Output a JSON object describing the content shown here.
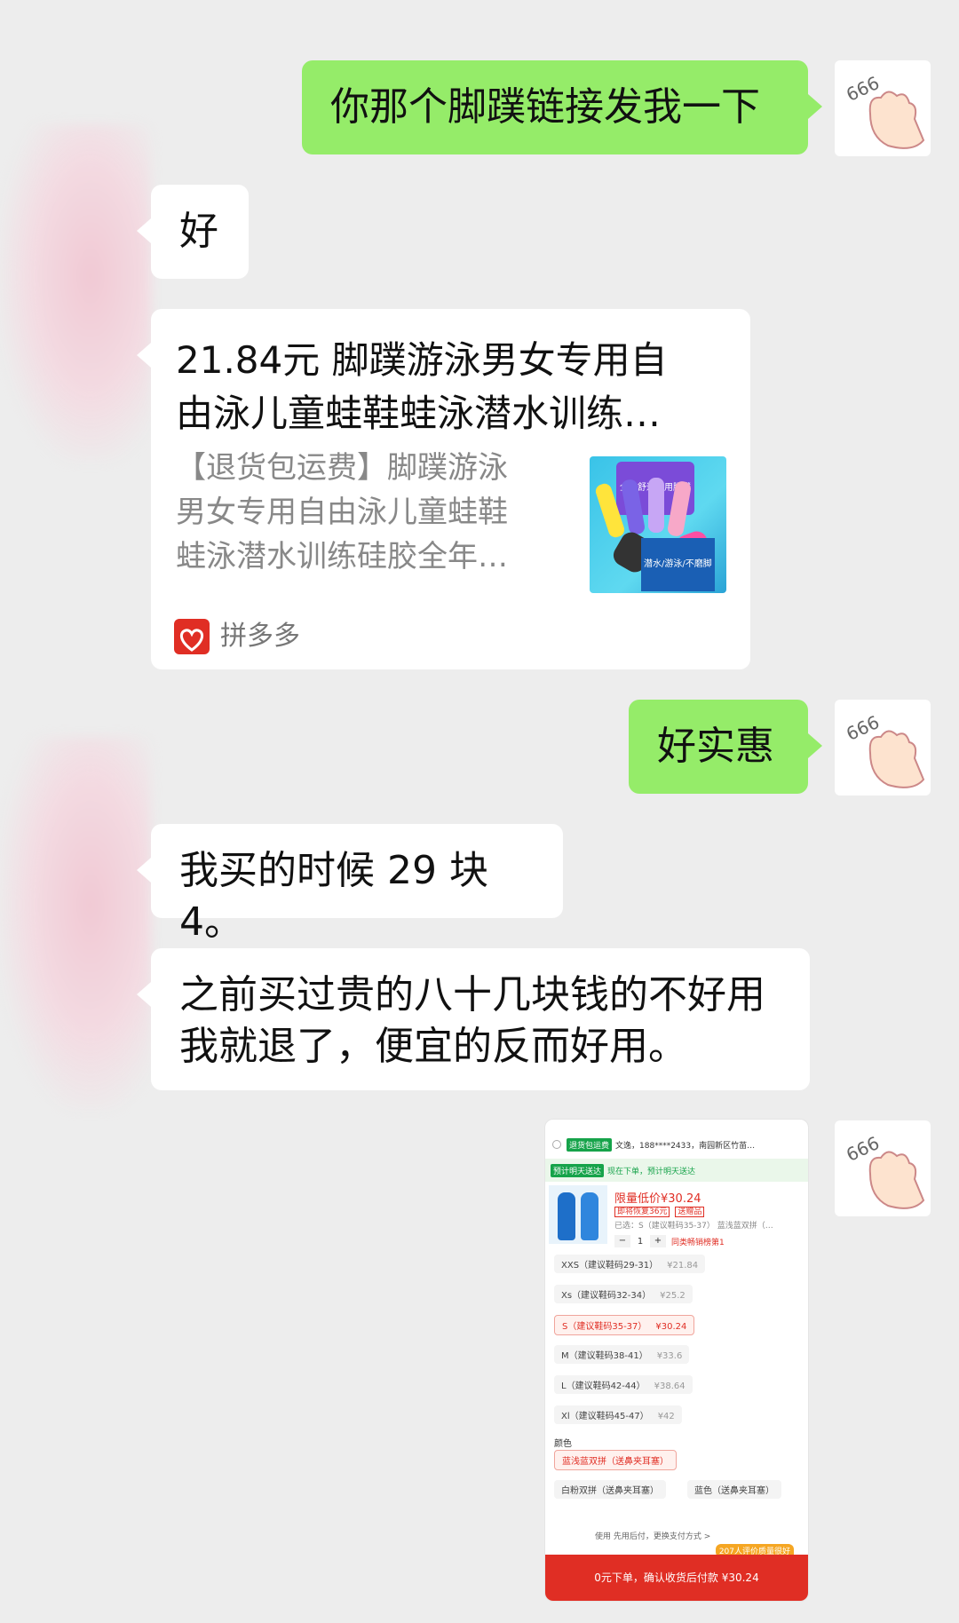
{
  "messages": [
    {
      "side": "right",
      "type": "text",
      "text": "你那个脚蹼链接发我一下"
    },
    {
      "side": "left",
      "type": "text",
      "text": "好"
    },
    {
      "side": "left",
      "type": "link_card",
      "title": "21.84元 脚蹼游泳男女专用自由泳儿童蛙鞋蛙泳潜水训练…",
      "title_line1": "21.84元 脚蹼游泳男女专用自",
      "title_line2": "由泳儿童蛙鞋蛙泳潜水训练…",
      "desc_line1": "【退货包运费】脚蹼游泳",
      "desc_line2": "男女专用自由泳儿童蛙鞋",
      "desc_line3": "蛙泳潜水训练硅胶全年…",
      "thumb_banner": "全年舒适耐用脚蹼",
      "thumb_footer": "潜水/游泳/不磨脚",
      "source": "拼多多"
    },
    {
      "side": "right",
      "type": "text",
      "text": "好实惠"
    },
    {
      "side": "left",
      "type": "text",
      "text": "我买的时候 29 块 4。"
    },
    {
      "side": "left",
      "type": "text",
      "line1": "之前买过贵的八十几块钱的不好用",
      "line2": "我就退了，便宜的反而好用。"
    },
    {
      "side": "right",
      "type": "image"
    }
  ],
  "avatar_text": "666",
  "screenshot": {
    "tag_return": "退货包运费",
    "address": "文逸，188****2433，南园新区竹苗…",
    "tag_delivery": "预计明天送达",
    "delivery_text": "现在下单，预计明天送达",
    "price_label": "限量低价¥30.24",
    "tag_recover": "即将恢复36元",
    "tag_gift": "送赠品",
    "selected": "已选：S（建议鞋码35-37） 蓝浅蓝双拼（…",
    "qty": "1",
    "rank": "同类畅销榜第1",
    "sizes": [
      {
        "label": "XXS（建议鞋码29-31）",
        "price": "¥21.84"
      },
      {
        "label": "Xs（建议鞋码32-34）",
        "price": "¥25.2"
      },
      {
        "label": "S（建议鞋码35-37）",
        "price": "¥30.24"
      },
      {
        "label": "M（建议鞋码38-41）",
        "price": "¥33.6"
      },
      {
        "label": "L（建议鞋码42-44）",
        "price": "¥38.64"
      },
      {
        "label": "Xl（建议鞋码45-47）",
        "price": "¥42"
      }
    ],
    "color_heading": "颜色",
    "colors": [
      "蓝浅蓝双拼（送鼻夹耳塞）",
      "白粉双拼（送鼻夹耳塞）",
      "蓝色（送鼻夹耳塞）"
    ],
    "pay_note": "使用 先用后付，更换支付方式 >",
    "review_badge": "207人评价质量很好",
    "order_button": "0元下单，确认收货后付款 ¥30.24"
  },
  "colors": {
    "green_bubble": "#95ec69",
    "background": "#ededed",
    "pdd_red": "#e02e24"
  }
}
